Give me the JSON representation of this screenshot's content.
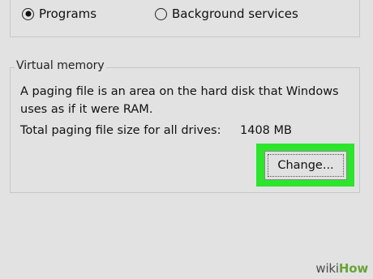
{
  "performance": {
    "radio_programs": "Programs",
    "radio_background": "Background services",
    "selected": "Programs"
  },
  "virtual_memory": {
    "legend": "Virtual memory",
    "description": "A paging file is an area on the hard disk that Windows uses as if it were RAM.",
    "total_label": "Total paging file size for all drives:",
    "total_value": "1408 MB",
    "change_button": "Change..."
  },
  "colors": {
    "background": "#e2e2e2",
    "highlight": "#2ce52c"
  },
  "watermark": {
    "part1": "wiki",
    "part2": "How"
  }
}
